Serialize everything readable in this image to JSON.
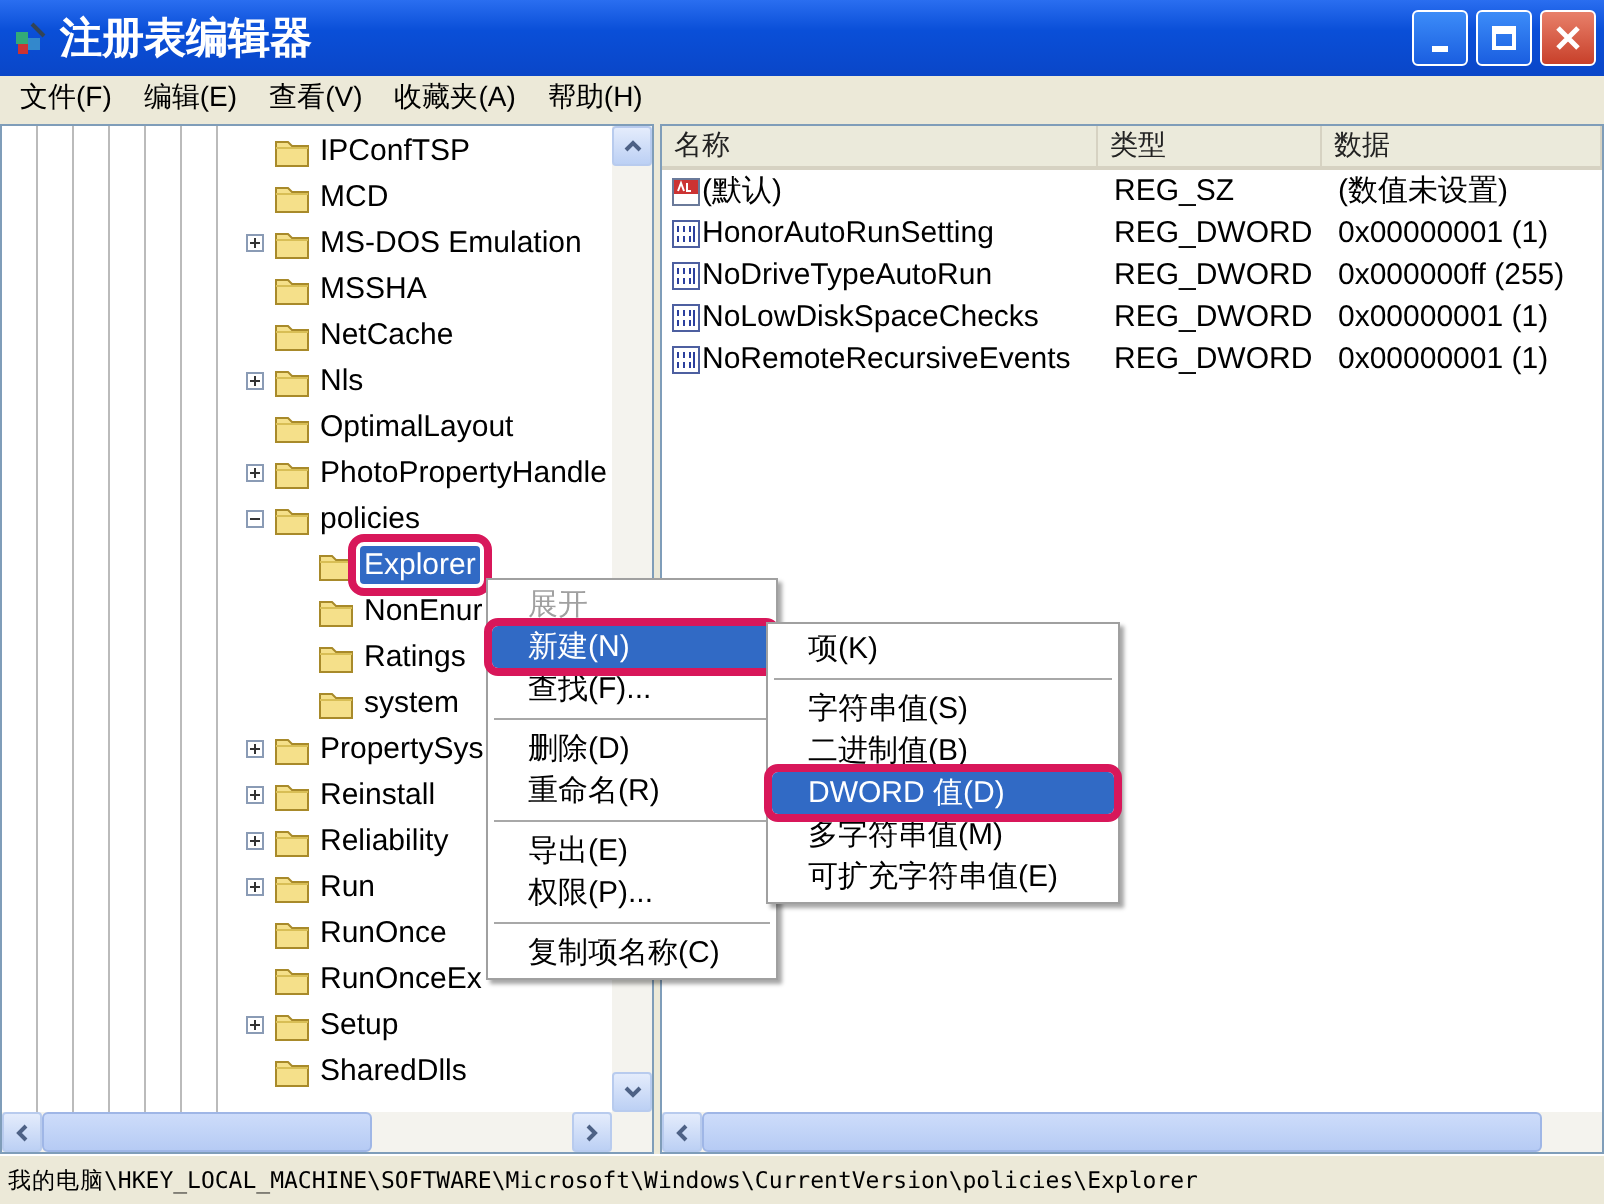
{
  "window": {
    "title": "注册表编辑器"
  },
  "menu_bar": [
    "文件(F)",
    "编辑(E)",
    "查看(V)",
    "收藏夹(A)",
    "帮助(H)"
  ],
  "tree": [
    {
      "label": "IPConfTSP",
      "selected": false
    },
    {
      "label": "MCD",
      "selected": false
    },
    {
      "label": "MS-DOS Emulation",
      "selected": false,
      "expanded": false
    },
    {
      "label": "MSSHA",
      "selected": false
    },
    {
      "label": "NetCache",
      "selected": false
    },
    {
      "label": "Nls",
      "selected": false,
      "expanded": false
    },
    {
      "label": "OptimalLayout",
      "selected": false
    },
    {
      "label": "PhotoPropertyHandle",
      "selected": false,
      "expanded": false
    },
    {
      "label": "policies",
      "selected": false,
      "expanded": true,
      "children": [
        {
          "label": "Explorer",
          "selected": true,
          "highlighted": true
        },
        {
          "label": "NonEnur",
          "selected": false
        },
        {
          "label": "Ratings",
          "selected": false
        },
        {
          "label": "system",
          "selected": false
        }
      ]
    },
    {
      "label": "PropertySys",
      "selected": false,
      "expanded": false
    },
    {
      "label": "Reinstall",
      "selected": false,
      "expanded": false
    },
    {
      "label": "Reliability",
      "selected": false,
      "expanded": false
    },
    {
      "label": "Run",
      "selected": false,
      "expanded": false
    },
    {
      "label": "RunOnce",
      "selected": false
    },
    {
      "label": "RunOnceEx",
      "selected": false
    },
    {
      "label": "Setup",
      "selected": false,
      "expanded": false
    },
    {
      "label": "SharedDlls",
      "selected": false
    }
  ],
  "values": {
    "columns": [
      "名称",
      "类型",
      "数据"
    ],
    "rows": [
      {
        "kind": "string",
        "name": "(默认)",
        "type": "REG_SZ",
        "data": "(数值未设置)"
      },
      {
        "kind": "dword",
        "name": "HonorAutoRunSetting",
        "type": "REG_DWORD",
        "data": "0x00000001 (1)"
      },
      {
        "kind": "dword",
        "name": "NoDriveTypeAutoRun",
        "type": "REG_DWORD",
        "data": "0x000000ff (255)"
      },
      {
        "kind": "dword",
        "name": "NoLowDiskSpaceChecks",
        "type": "REG_DWORD",
        "data": "0x00000001 (1)"
      },
      {
        "kind": "dword",
        "name": "NoRemoteRecursiveEvents",
        "type": "REG_DWORD",
        "data": "0x00000001 (1)"
      }
    ]
  },
  "context_menu": [
    {
      "kind": "item",
      "label": "展开",
      "disabled": true,
      "selected": false
    },
    {
      "kind": "item",
      "label": "新建(N)",
      "disabled": false,
      "selected": true,
      "highlighted": true
    },
    {
      "kind": "item",
      "label": "查找(F)...",
      "disabled": false,
      "selected": false
    },
    {
      "kind": "separator"
    },
    {
      "kind": "item",
      "label": "删除(D)",
      "disabled": false,
      "selected": false
    },
    {
      "kind": "item",
      "label": "重命名(R)",
      "disabled": false,
      "selected": false
    },
    {
      "kind": "separator"
    },
    {
      "kind": "item",
      "label": "导出(E)",
      "disabled": false,
      "selected": false
    },
    {
      "kind": "item",
      "label": "权限(P)...",
      "disabled": false,
      "selected": false
    },
    {
      "kind": "separator"
    },
    {
      "kind": "item",
      "label": "复制项名称(C)",
      "disabled": false,
      "selected": false
    }
  ],
  "submenu": [
    {
      "kind": "item",
      "label": "项(K)",
      "disabled": false,
      "selected": false
    },
    {
      "kind": "separator"
    },
    {
      "kind": "item",
      "label": "字符串值(S)",
      "disabled": false,
      "selected": false
    },
    {
      "kind": "item",
      "label": "二进制值(B)",
      "disabled": false,
      "selected": false
    },
    {
      "kind": "item",
      "label": "DWORD 值(D)",
      "disabled": false,
      "selected": true,
      "highlighted": true
    },
    {
      "kind": "item",
      "label": "多字符串值(M)",
      "disabled": false,
      "selected": false
    },
    {
      "kind": "item",
      "label": "可扩充字符串值(E)",
      "disabled": false,
      "selected": false
    }
  ],
  "status_bar": "我的电脑\\HKEY_LOCAL_MACHINE\\SOFTWARE\\Microsoft\\Windows\\CurrentVersion\\policies\\Explorer"
}
